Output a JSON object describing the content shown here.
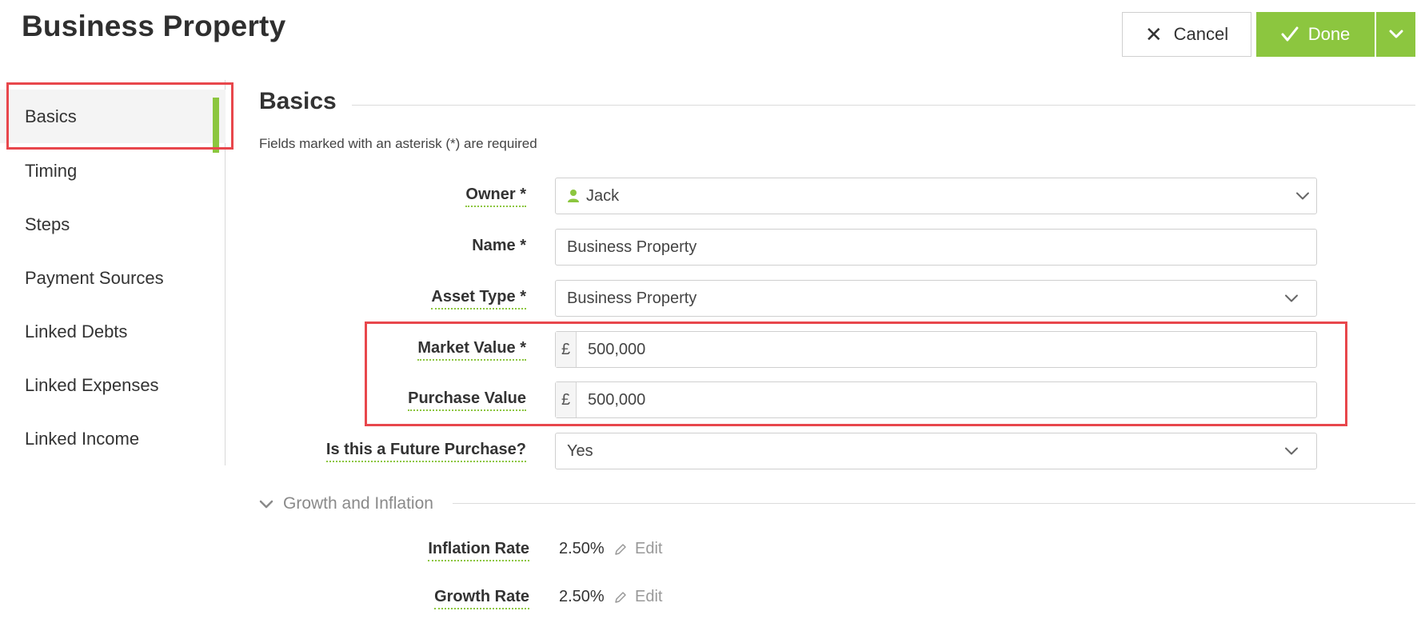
{
  "header": {
    "title": "Business Property",
    "cancel_label": "Cancel",
    "done_label": "Done"
  },
  "sidebar": {
    "items": [
      {
        "label": "Basics",
        "active": true
      },
      {
        "label": "Timing"
      },
      {
        "label": "Steps"
      },
      {
        "label": "Payment Sources"
      },
      {
        "label": "Linked Debts"
      },
      {
        "label": "Linked Expenses"
      },
      {
        "label": "Linked Income"
      }
    ]
  },
  "main": {
    "section_title": "Basics",
    "required_note": "Fields marked with an asterisk (*) are required",
    "fields": {
      "owner": {
        "label": "Owner *",
        "value": "Jack"
      },
      "name": {
        "label": "Name *",
        "value": "Business Property"
      },
      "asset_type": {
        "label": "Asset Type *",
        "value": "Business Property"
      },
      "market_value": {
        "label": "Market Value *",
        "currency": "£",
        "value": "500,000"
      },
      "purchase_value": {
        "label": "Purchase Value",
        "currency": "£",
        "value": "500,000"
      },
      "future_purchase": {
        "label": "Is this a Future Purchase?",
        "value": "Yes"
      }
    },
    "growth": {
      "title": "Growth and Inflation",
      "inflation": {
        "label": "Inflation Rate",
        "value": "2.50%",
        "edit_label": "Edit"
      },
      "growth_rate": {
        "label": "Growth Rate",
        "value": "2.50%",
        "edit_label": "Edit"
      }
    }
  },
  "colors": {
    "accent": "#8cc63f",
    "highlight": "#e8474c"
  },
  "icons": {
    "cancel": "close-icon",
    "done": "check-icon",
    "split": "chevron-down-icon",
    "owner": "user-icon",
    "edit": "pencil-icon"
  }
}
